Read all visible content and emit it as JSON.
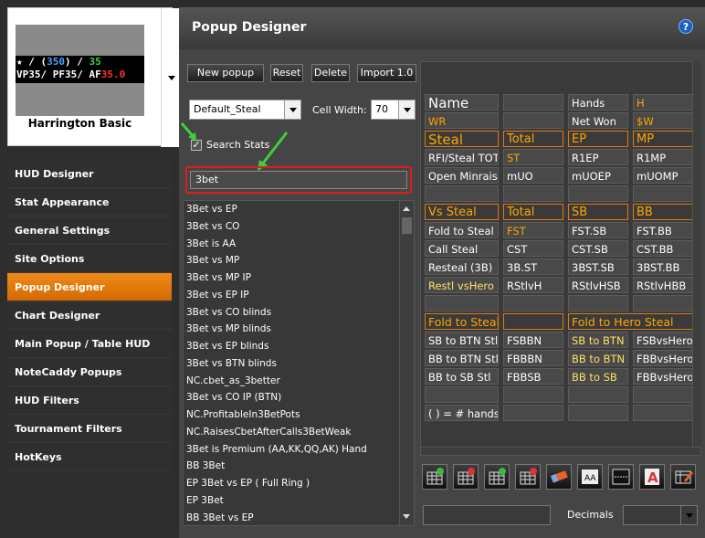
{
  "hud_card": {
    "name": "Harrington Basic",
    "line1_a": "★ / (",
    "line1_b": "350",
    "line1_c": ") /",
    "line1_d": "35",
    "line2_a": "VP",
    "line2_b": "35",
    "line2_c": "/ PF",
    "line2_d": "35",
    "line2_e": "/ AF",
    "line2_f": "35.0"
  },
  "sidebar": {
    "items": [
      {
        "label": "HUD Designer"
      },
      {
        "label": "Stat Appearance"
      },
      {
        "label": "General Settings"
      },
      {
        "label": "Site Options"
      },
      {
        "label": "Popup Designer"
      },
      {
        "label": "Chart Designer"
      },
      {
        "label": "Main Popup / Table HUD"
      },
      {
        "label": "NoteCaddy Popups"
      },
      {
        "label": "HUD Filters"
      },
      {
        "label": "Tournament Filters"
      },
      {
        "label": "HotKeys"
      }
    ]
  },
  "header": {
    "title": "Popup Designer",
    "help_icon": "?"
  },
  "toolbar": {
    "new_popup": "New popup",
    "reset": "Reset",
    "delete": "Delete",
    "import": "Import 1.0"
  },
  "popup_select": {
    "value": "Default_Steal"
  },
  "cell_width": {
    "label": "Cell Width:",
    "value": "70"
  },
  "search_stats": {
    "label": "Search Stats",
    "checked": "✓"
  },
  "search": {
    "value": "3bet"
  },
  "stat_list": [
    "3Bet vs EP",
    "3Bet vs CO",
    "3Bet is AA",
    "3Bet vs MP",
    "3Bet vs MP IP",
    "3Bet vs EP IP",
    "3Bet vs CO blinds",
    "3Bet vs MP blinds",
    "3Bet vs EP blinds",
    "3Bet vs BTN blinds",
    "NC.cbet_as_3better",
    "3Bet vs CO IP (BTN)",
    "NC.ProfitableIn3BetPots",
    "NC.RaisesCbetAfterCalls3BetWeak",
    "3Bet is Premium (AA,KK,QQ,AK) Hand",
    "BB 3Bet",
    "EP 3Bet vs EP ( Full Ring )",
    "EP 3Bet",
    "BB 3Bet vs EP"
  ],
  "grid": {
    "r1": [
      "Name",
      "",
      "Hands",
      "H"
    ],
    "r2": [
      "WR",
      "",
      "Net Won",
      "$W"
    ],
    "r3": [
      "Steal",
      "Total",
      "EP",
      "MP"
    ],
    "r4": [
      "RFI/Steal TOT",
      "ST",
      "R1EP",
      "R1MP"
    ],
    "r5": [
      "Open Minraise",
      "mUO",
      "mUOEP",
      "mUOMP"
    ],
    "r7": [
      "Vs Steal",
      "Total",
      "SB",
      "BB"
    ],
    "r8": [
      "Fold to Steal",
      "FST",
      "FST.SB",
      "FST.BB"
    ],
    "r9": [
      "Call Steal",
      "CST",
      "CST.SB",
      "CST.BB"
    ],
    "r10": [
      "Resteal (3B)",
      "3B.ST",
      "3BST.SB",
      "3BST.BB"
    ],
    "r11": [
      "Restl vsHero",
      "RStlvH",
      "RStlvHSB",
      "RStlvHBB"
    ],
    "r13": [
      "Fold to Steal",
      "",
      "Fold to Hero Steal",
      ""
    ],
    "r14": [
      "SB to BTN Stl",
      "FSBBN",
      "SB to BTN",
      "FSBvsHero"
    ],
    "r15": [
      "BB to BTN Stl",
      "FBBBN",
      "BB to BTN",
      "FBBvsHero"
    ],
    "r16": [
      "BB to SB Stl",
      "FBBSB",
      "BB to SB",
      "FBBvsHero"
    ],
    "r18": [
      "( ) = # hands"
    ]
  },
  "bottom": {
    "decimals_label": "Decimals"
  },
  "tools": [
    "add-row-icon",
    "remove-row-icon",
    "add-column-icon",
    "remove-column-icon",
    "eraser-icon",
    "font-size-icon",
    "cell-border-icon",
    "text-color-icon",
    "edit-properties-icon"
  ],
  "colors": {
    "accent": "#f07f14",
    "highlight_red": "#e01c1c",
    "arrow_green": "#3cd13c",
    "grid_orange": "#ffa500"
  }
}
